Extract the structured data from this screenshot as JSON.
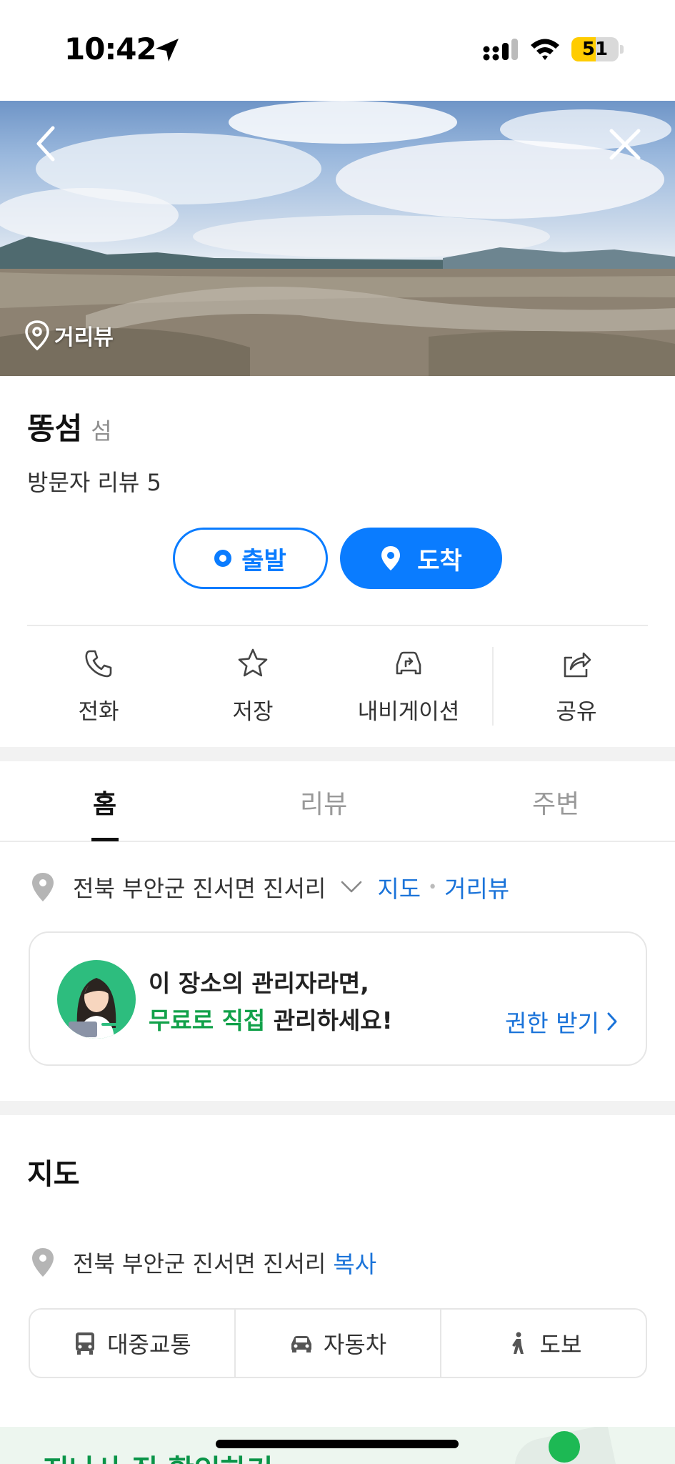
{
  "status_bar": {
    "time": "10:42",
    "battery": "51",
    "battery_level": 0.51
  },
  "hero": {
    "street_view_label": "거리뷰"
  },
  "place": {
    "name": "똥섬",
    "category": "섬",
    "visitor_review": "방문자 리뷰 5"
  },
  "route_buttons": {
    "depart": "출발",
    "arrive": "도착"
  },
  "actions": {
    "call": "전화",
    "save": "저장",
    "navigation": "내비게이션",
    "share": "공유"
  },
  "tabs": [
    {
      "label": "홈",
      "active": true
    },
    {
      "label": "리뷰",
      "active": false
    },
    {
      "label": "주변",
      "active": false
    }
  ],
  "address": {
    "text": "전북 부안군 진서면 진서리",
    "map_link": "지도",
    "street_view_link": "거리뷰"
  },
  "owner_card": {
    "line1": "이 장소의 관리자라면,",
    "line2_highlight": "무료로 직접",
    "line2_rest": " 관리하세요!",
    "action": "권한 받기"
  },
  "map_section": {
    "heading": "지도",
    "address": "전북 부안군 진서면 진서리",
    "copy": "복사"
  },
  "transport": {
    "public": "대중교통",
    "car": "자동차",
    "walk": "도보"
  },
  "bottom_peek": {
    "text": "지나사 직 확인하기"
  },
  "colors": {
    "accent_blue": "#0a7cff",
    "link_blue": "#1a73d9",
    "green": "#12a14a"
  }
}
